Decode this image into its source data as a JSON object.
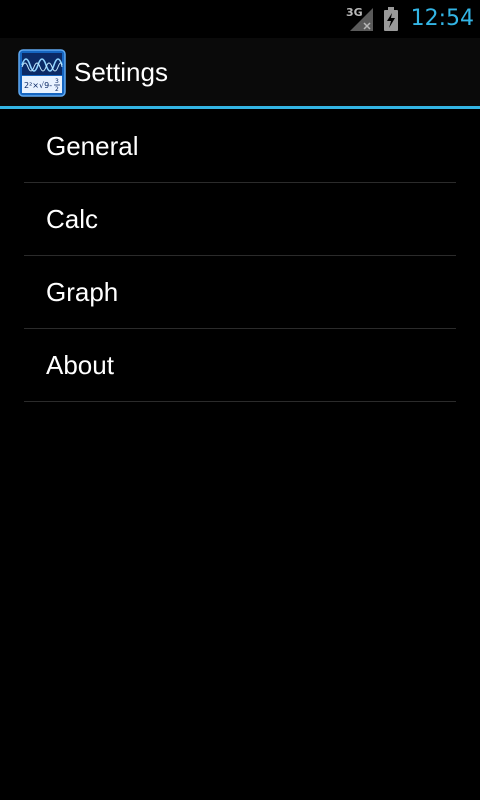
{
  "status_bar": {
    "network": "3G",
    "time": "12:54",
    "signal_icon": "signal-no-service-icon",
    "battery_icon": "battery-charging-icon",
    "accent_color": "#33b5e5"
  },
  "action_bar": {
    "title": "Settings",
    "app_icon": "graphing-calculator-app-icon"
  },
  "settings": {
    "items": [
      {
        "label": "General"
      },
      {
        "label": "Calc"
      },
      {
        "label": "Graph"
      },
      {
        "label": "About"
      }
    ]
  },
  "colors": {
    "background": "#000000",
    "accent": "#33b5e5",
    "divider": "#2b2b2b"
  }
}
